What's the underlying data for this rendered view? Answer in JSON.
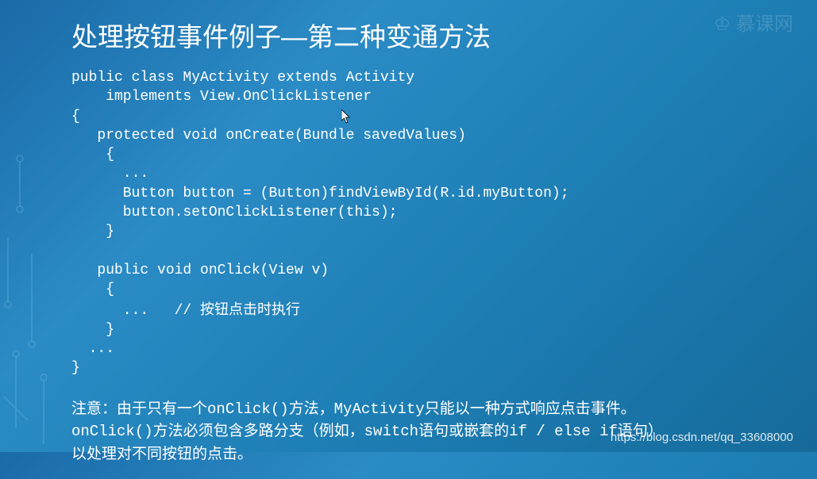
{
  "title": "处理按钮事件例子—第二种变通方法",
  "code": {
    "line1": "public class MyActivity extends Activity",
    "line2": "    implements View.OnClickListener",
    "line3": "{",
    "line4": "   protected void onCreate(Bundle savedValues)",
    "line5": "    {",
    "line6": "      ...",
    "line7": "      Button button = (Button)findViewById(R.id.myButton);",
    "line8": "      button.setOnClickListener(this);",
    "line9": "    }",
    "line10": "",
    "line11": "   public void onClick(View v)",
    "line12": "    {",
    "line13_code": "      ...   // ",
    "line13_comment": "按钮点击时执行",
    "line14": "    }",
    "line15": "  ...",
    "line16": "}"
  },
  "note": {
    "line1_prefix": "注意：由于只有一个",
    "line1_code1": "onClick()",
    "line1_mid": "方法，",
    "line1_code2": "MyActivity",
    "line1_suffix": "只能以一种方式响应点击事件。",
    "line2_code1": "onClick()",
    "line2_mid1": "方法必须包含多路分支（例如，",
    "line2_code2": "switch",
    "line2_mid2": "语句或嵌套的",
    "line2_code3": "if / else if",
    "line2_suffix": "语句）",
    "line3": "以处理对不同按钮的点击。"
  },
  "url": "https://blog.csdn.net/qq_33608000",
  "watermark_text": "慕课网"
}
